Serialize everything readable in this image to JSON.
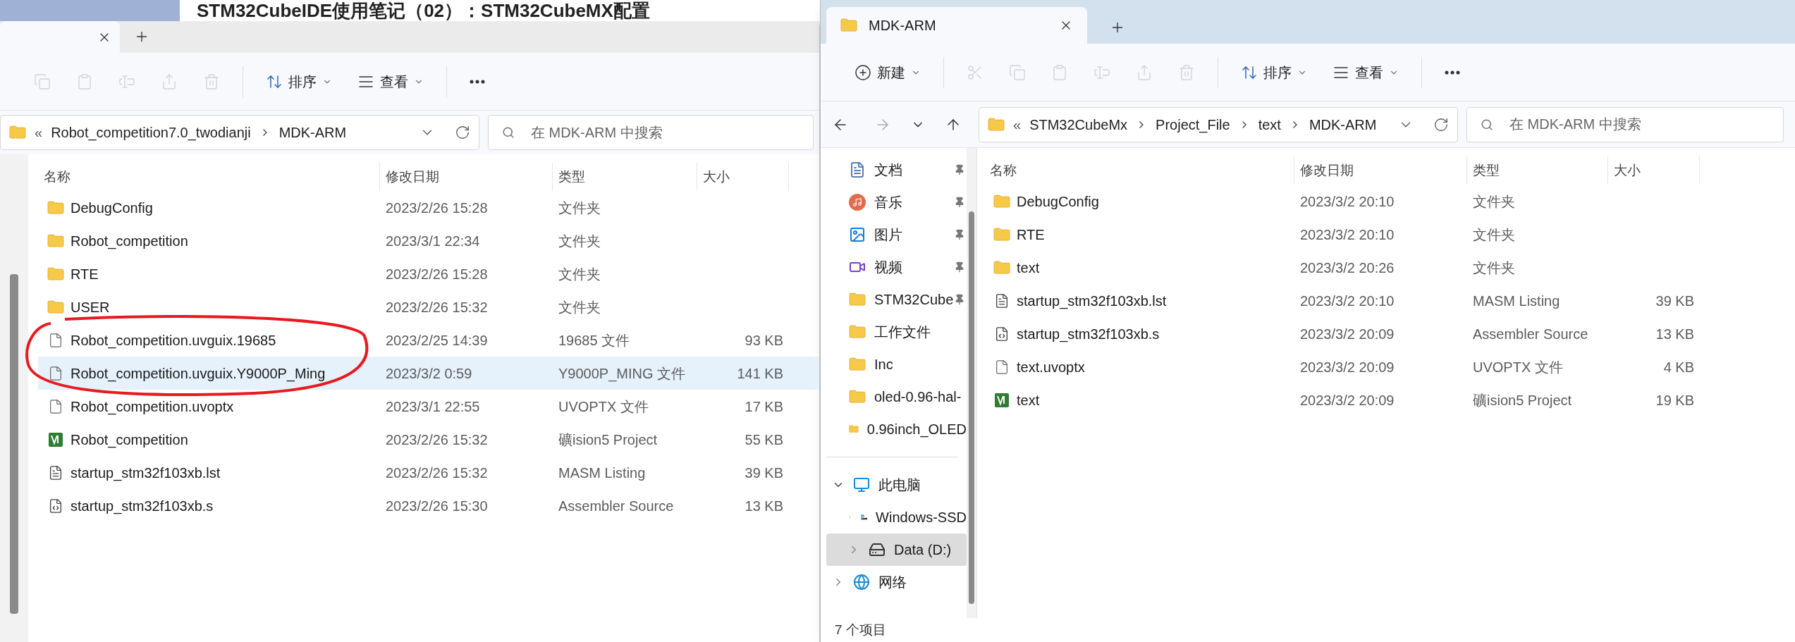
{
  "background_heading": "STM32CubeIDE使用笔记（02）：STM32CubeMX配置",
  "left_window": {
    "tabs": [
      {
        "selected": true
      }
    ],
    "toolbar": [
      {
        "kind": "copy",
        "disabled": true
      },
      {
        "kind": "paste",
        "disabled": true
      },
      {
        "kind": "rename",
        "disabled": true
      },
      {
        "kind": "share",
        "disabled": true
      },
      {
        "kind": "delete",
        "disabled": true
      },
      {
        "kind": "sort",
        "label": "排序",
        "disabled": false
      },
      {
        "kind": "view",
        "label": "查看",
        "disabled": false
      },
      {
        "kind": "more",
        "disabled": false
      }
    ],
    "address": {
      "overflow_mark": "«",
      "path": [
        "Robot_competition7.0_twodianji",
        "MDK-ARM"
      ]
    },
    "search": {
      "placeholder": "在 MDK-ARM 中搜索"
    },
    "columns": [
      "名称",
      "修改日期",
      "类型",
      "大小"
    ],
    "rows": [
      {
        "kind": "folder",
        "name": "DebugConfig",
        "date": "2023/2/26 15:28",
        "type": "文件夹",
        "size": "",
        "selected": false,
        "circled": false
      },
      {
        "kind": "folder",
        "name": "Robot_competition",
        "date": "2023/3/1 22:34",
        "type": "文件夹",
        "size": "",
        "selected": false,
        "circled": false
      },
      {
        "kind": "folder",
        "name": "RTE",
        "date": "2023/2/26 15:28",
        "type": "文件夹",
        "size": "",
        "selected": false,
        "circled": false
      },
      {
        "kind": "folder",
        "name": "USER",
        "date": "2023/2/26 15:32",
        "type": "文件夹",
        "size": "",
        "selected": false,
        "circled": false
      },
      {
        "kind": "file",
        "name": "Robot_competition.uvguix.19685",
        "date": "2023/2/25 14:39",
        "type": "19685 文件",
        "size": "93 KB",
        "selected": false,
        "circled": true
      },
      {
        "kind": "file",
        "name": "Robot_competition.uvguix.Y9000P_Ming",
        "date": "2023/3/2 0:59",
        "type": "Y9000P_MING 文件",
        "size": "141 KB",
        "selected": true,
        "circled": true
      },
      {
        "kind": "file",
        "name": "Robot_competition.uvoptx",
        "date": "2023/3/1 22:55",
        "type": "UVOPTX 文件",
        "size": "17 KB",
        "selected": false,
        "circled": false
      },
      {
        "kind": "project",
        "name": "Robot_competition",
        "date": "2023/2/26 15:32",
        "type": "礦ision5 Project",
        "size": "55 KB",
        "selected": false,
        "circled": false
      },
      {
        "kind": "listing",
        "name": "startup_stm32f103xb.lst",
        "date": "2023/2/26 15:32",
        "type": "MASM Listing",
        "size": "39 KB",
        "selected": false,
        "circled": false
      },
      {
        "kind": "assembler",
        "name": "startup_stm32f103xb.s",
        "date": "2023/2/26 15:30",
        "type": "Assembler Source",
        "size": "13 KB",
        "selected": false,
        "circled": false
      }
    ]
  },
  "right_window": {
    "tabs": [
      {
        "label": "MDK-ARM",
        "selected": true
      }
    ],
    "toolbar": [
      {
        "kind": "new",
        "label": "新建",
        "disabled": false
      },
      {
        "kind": "cut",
        "disabled": true
      },
      {
        "kind": "copy",
        "disabled": true
      },
      {
        "kind": "paste",
        "disabled": true
      },
      {
        "kind": "rename",
        "disabled": true
      },
      {
        "kind": "share",
        "disabled": true
      },
      {
        "kind": "delete",
        "disabled": true
      },
      {
        "kind": "sort",
        "label": "排序",
        "disabled": false
      },
      {
        "kind": "view",
        "label": "查看",
        "disabled": false
      },
      {
        "kind": "more",
        "disabled": false
      }
    ],
    "address": {
      "overflow_mark": "«",
      "path": [
        "STM32CubeMx",
        "Project_File",
        "text",
        "MDK-ARM"
      ]
    },
    "search": {
      "placeholder": "在 MDK-ARM 中搜索"
    },
    "quick_access": [
      {
        "kind": "documents",
        "label": "文档",
        "pinned": true
      },
      {
        "kind": "music",
        "label": "音乐",
        "pinned": true
      },
      {
        "kind": "pictures",
        "label": "图片",
        "pinned": true
      },
      {
        "kind": "videos",
        "label": "视频",
        "pinned": true
      },
      {
        "kind": "folder",
        "label": "STM32Cube",
        "pinned": true
      },
      {
        "kind": "folder",
        "label": "工作文件",
        "pinned": false
      },
      {
        "kind": "folder",
        "label": "Inc",
        "pinned": false
      },
      {
        "kind": "folder",
        "label": "oled-0.96-hal-",
        "pinned": false
      },
      {
        "kind": "folder",
        "label": "0.96inch_OLED",
        "pinned": false
      }
    ],
    "tree": [
      {
        "kind": "pc",
        "label": "此电脑",
        "expanded": true,
        "selected": false,
        "children": [
          {
            "kind": "system_drive",
            "label": "Windows-SSD",
            "expanded": false,
            "selected": false
          },
          {
            "kind": "drive",
            "label": "Data (D:)",
            "expanded": false,
            "selected": true
          }
        ]
      },
      {
        "kind": "network",
        "label": "网络",
        "expanded": false,
        "selected": false
      }
    ],
    "columns": [
      "名称",
      "修改日期",
      "类型",
      "大小"
    ],
    "rows": [
      {
        "kind": "folder",
        "name": "DebugConfig",
        "date": "2023/3/2 20:10",
        "type": "文件夹",
        "size": "",
        "selected": false
      },
      {
        "kind": "folder",
        "name": "RTE",
        "date": "2023/3/2 20:10",
        "type": "文件夹",
        "size": "",
        "selected": false
      },
      {
        "kind": "folder",
        "name": "text",
        "date": "2023/3/2 20:26",
        "type": "文件夹",
        "size": "",
        "selected": false
      },
      {
        "kind": "listing",
        "name": "startup_stm32f103xb.lst",
        "date": "2023/3/2 20:10",
        "type": "MASM Listing",
        "size": "39 KB",
        "selected": false
      },
      {
        "kind": "assembler",
        "name": "startup_stm32f103xb.s",
        "date": "2023/3/2 20:09",
        "type": "Assembler Source",
        "size": "13 KB",
        "selected": false
      },
      {
        "kind": "file",
        "name": "text.uvoptx",
        "date": "2023/3/2 20:09",
        "type": "UVOPTX 文件",
        "size": "4 KB",
        "selected": false
      },
      {
        "kind": "project",
        "name": "text",
        "date": "2023/3/2 20:09",
        "type": "礦ision5 Project",
        "size": "19 KB",
        "selected": false
      }
    ],
    "status": "7 个项目"
  }
}
